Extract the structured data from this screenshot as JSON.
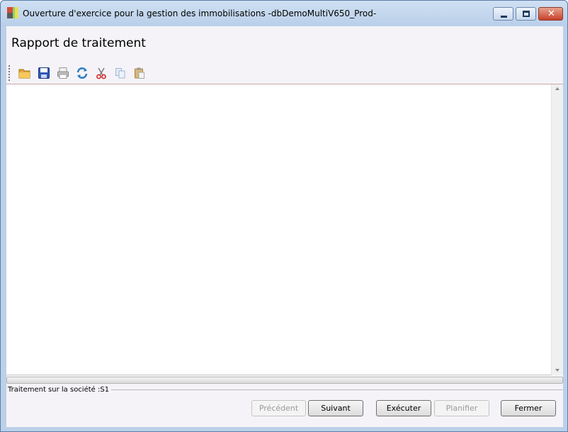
{
  "window": {
    "title": "Ouverture d'exercice pour la gestion des immobilisations -dbDemoMultiV650_Prod-"
  },
  "page": {
    "heading": "Rapport de traitement"
  },
  "toolbar": {
    "items": [
      {
        "icon": "open-folder-icon",
        "enabled": true
      },
      {
        "icon": "save-icon",
        "enabled": true
      },
      {
        "icon": "print-icon",
        "enabled": false
      },
      {
        "icon": "refresh-icon",
        "enabled": true
      },
      {
        "icon": "cut-icon",
        "enabled": true
      },
      {
        "icon": "copy-icon",
        "enabled": false
      },
      {
        "icon": "paste-icon",
        "enabled": false
      }
    ]
  },
  "report": {
    "content": ""
  },
  "status": {
    "text": "Traitement sur la société :S1"
  },
  "buttons": {
    "previous": "Précédent",
    "next": "Suivant",
    "execute": "Exécuter",
    "schedule": "Planifier",
    "close": "Fermer"
  }
}
